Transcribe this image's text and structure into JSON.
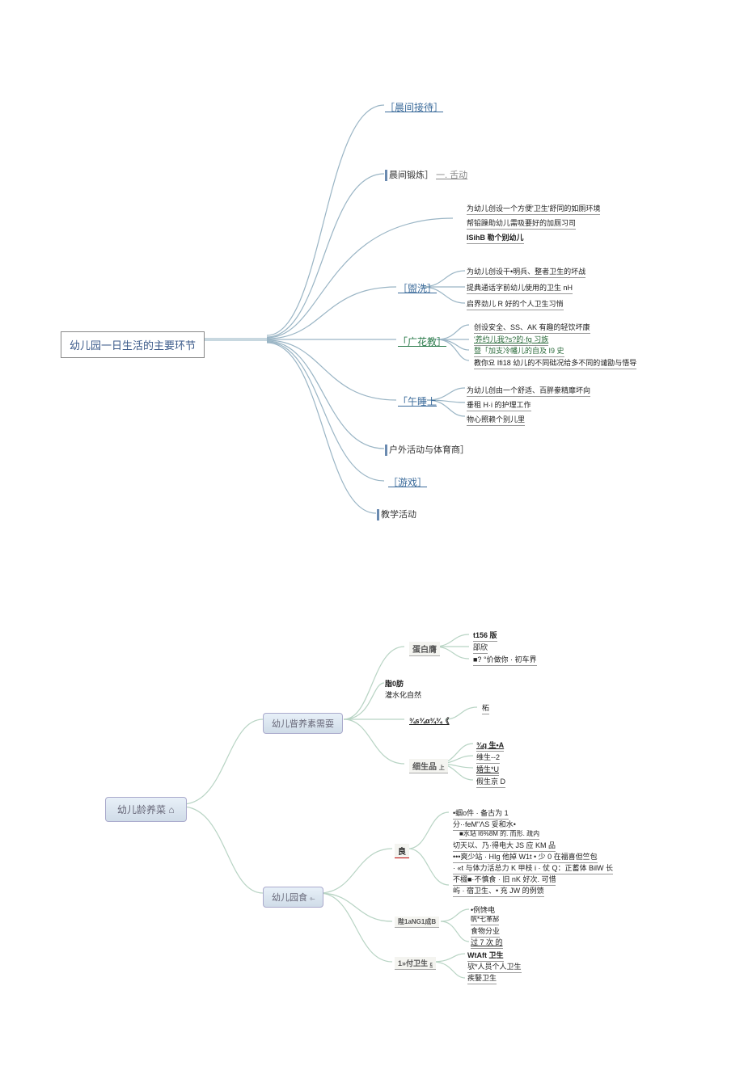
{
  "diagram1": {
    "root": "幼儿园一日生活的主要环节",
    "nodes": {
      "n1": "［晨间接待］",
      "n2": "晨间锻炼］",
      "n2s": "一. 舌动",
      "n3": "［盥洗］",
      "n4": "「广花教］",
      "n5": "「午睡上",
      "n6": "户外活动与体育商］",
      "n7": "［游戏］",
      "n8": "教学活动"
    },
    "leaves": {
      "g1": [
        "为幼儿创设一个方便'卫生'舒同的如厕环境",
        "帮铅躁助幼儿需吸要好的加厕习司",
        "ISihB 勒个别幼儿"
      ],
      "g2": [
        "为幼儿创设干•明兵、整者卫生的坏战",
        "提典通话字前幼儿使用的卫生 nH",
        "启界劲儿 R 好的个人卫生习悄"
      ],
      "g3": [
        "创设安全、SS、AK 有趣的轻饮坏康",
        "'养约儿我?s?的·fg 习族",
        "暨「加支冷幡儿的自及 I9 史",
        "教你요 Ifi18 幼儿的不同础况给多不同的谴勖与悟导"
      ],
      "g4": [
        "为幼儿创由一个舒适、百胖豢精靡坏向",
        "垂租 H·i 的护理工作",
        "物心照赖个别儿里"
      ]
    }
  },
  "diagram2": {
    "root": "幼儿龄养菜 ⌂",
    "branches": {
      "b1": "幼儿眥养素需耍",
      "b2": "幼儿园食"
    },
    "subs": {
      "s1": "蛋白膺",
      "s2": "脂0肪",
      "s2a": "灌水化自然",
      "s3": "¾s¾α¾¾《",
      "s3a": "柘",
      "s4": "细生品",
      "b2s1": "良",
      "b2s2": "陛1aNG1成B",
      "b2s3": "1»付卫生"
    },
    "leaves": {
      "s1l": [
        "t156 版",
        "郘欣",
        "■? °价做你 · 初车界"
      ],
      "s4l": [
        "¾q 生•A",
        "维生--2",
        "婚生*U",
        "假生京 D"
      ],
      "b2s1l": [
        "•蝈o件 · 备古为 1",
        "分··feM\"ΛS 妥和水•",
        "■水站 I6%8M 的. 而形. 疏内",
        "切天以、乃·得电大 JS 应 KM 品",
        "•••爽少站 · HIg 他掉 W1t • 少 0 在福喜但竺包",
        "· «t 与体力活总力 K 甲枝 i · 仗 Q：正蓄体 BilW 长",
        "不棳■·不慎食 · 旧 nK 好次. 可惜",
        "屿 · 宿卫生、• 充 JW 的例馈"
      ],
      "b2s2l": [
        "•例馋电",
        "帆*七革郝",
        "食物分业",
        "过  7  次 的"
      ],
      "b2s3l": [
        "WtAft 卫生",
        "欤*人员个人卫生",
        "疾嫛卫生"
      ]
    }
  }
}
